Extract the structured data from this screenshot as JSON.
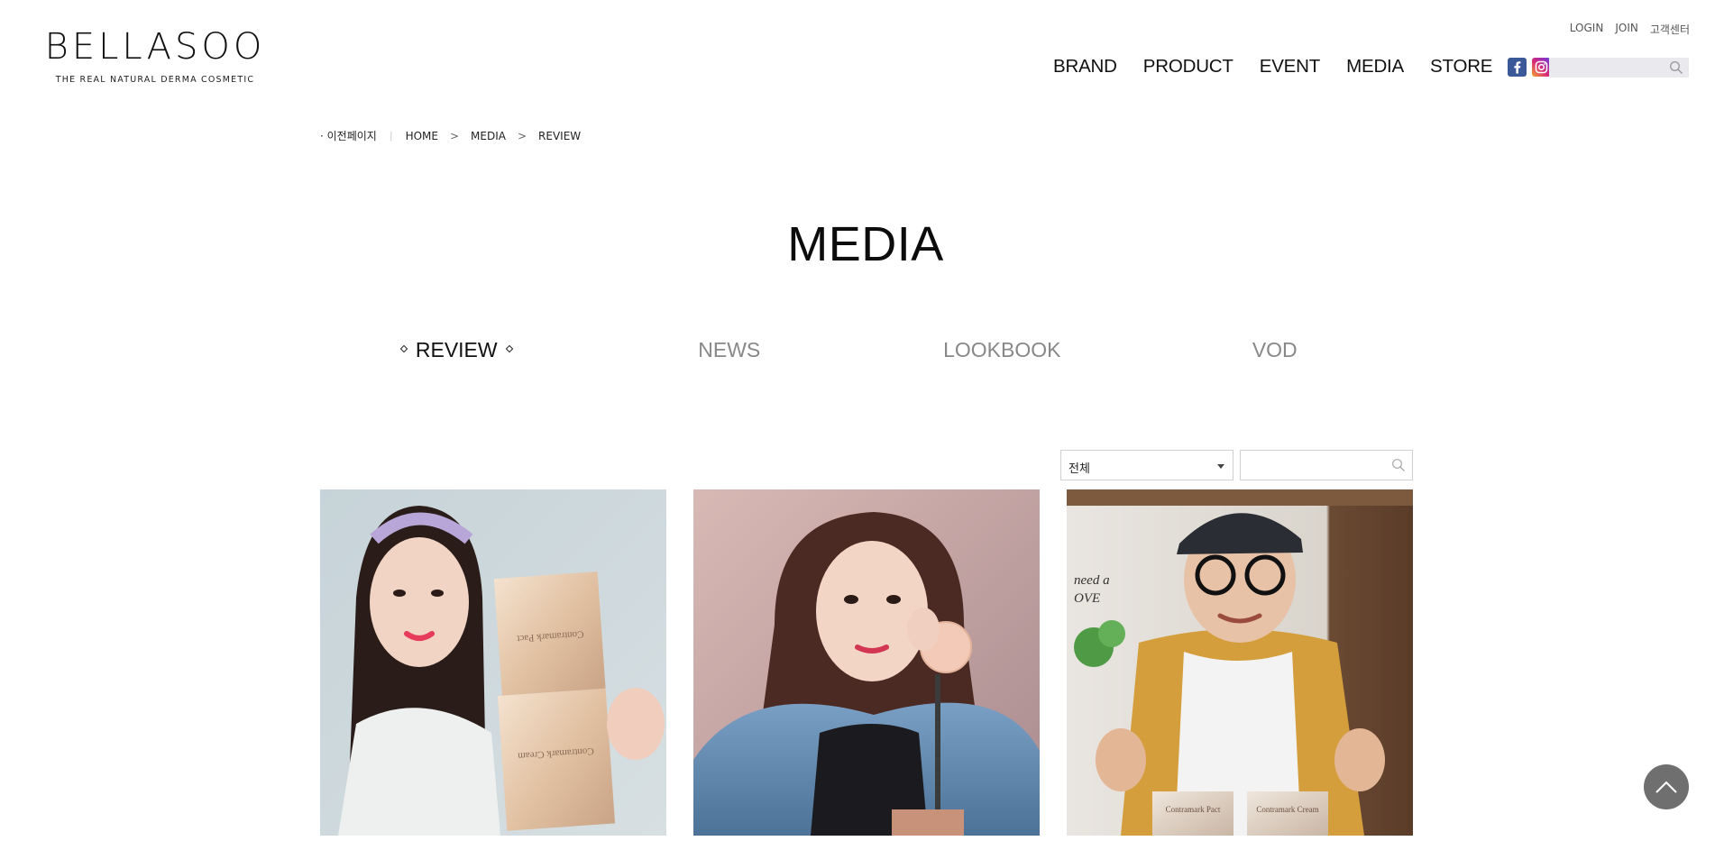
{
  "logo": {
    "word": "BELLASOO",
    "tagline": "THE REAL NATURAL DERMA COSMETIC"
  },
  "util_links": [
    "LOGIN",
    "JOIN",
    "고객센터"
  ],
  "nav": [
    "BRAND",
    "PRODUCT",
    "EVENT",
    "MEDIA",
    "STORE"
  ],
  "sns_icons": [
    "facebook-icon",
    "instagram-icon",
    "youtube-icon"
  ],
  "header_search": {
    "placeholder": ""
  },
  "breadcrumb": {
    "prev": "· 이전페이지",
    "items": [
      "HOME",
      "MEDIA",
      "REVIEW"
    ],
    "separator": ">"
  },
  "page_title": "MEDIA",
  "tabs": [
    {
      "label": "REVIEW",
      "active": true
    },
    {
      "label": "NEWS",
      "active": false
    },
    {
      "label": "LOOKBOOK",
      "active": false
    },
    {
      "label": "VOD",
      "active": false
    }
  ],
  "filter": {
    "selected": "전체",
    "search_value": ""
  },
  "reviews": [
    {
      "name": "review-card-1",
      "product_text": [
        "Contramark Pact",
        "Contramark Cream"
      ]
    },
    {
      "name": "review-card-2",
      "product_text": []
    },
    {
      "name": "review-card-3",
      "product_text": [
        "need a",
        "OVE",
        "Contramark Pact",
        "Contramark Cream"
      ]
    }
  ],
  "colors": {
    "accent": "#111111",
    "inactive_tab": "#888888",
    "top_button": "#6f6f6f"
  }
}
